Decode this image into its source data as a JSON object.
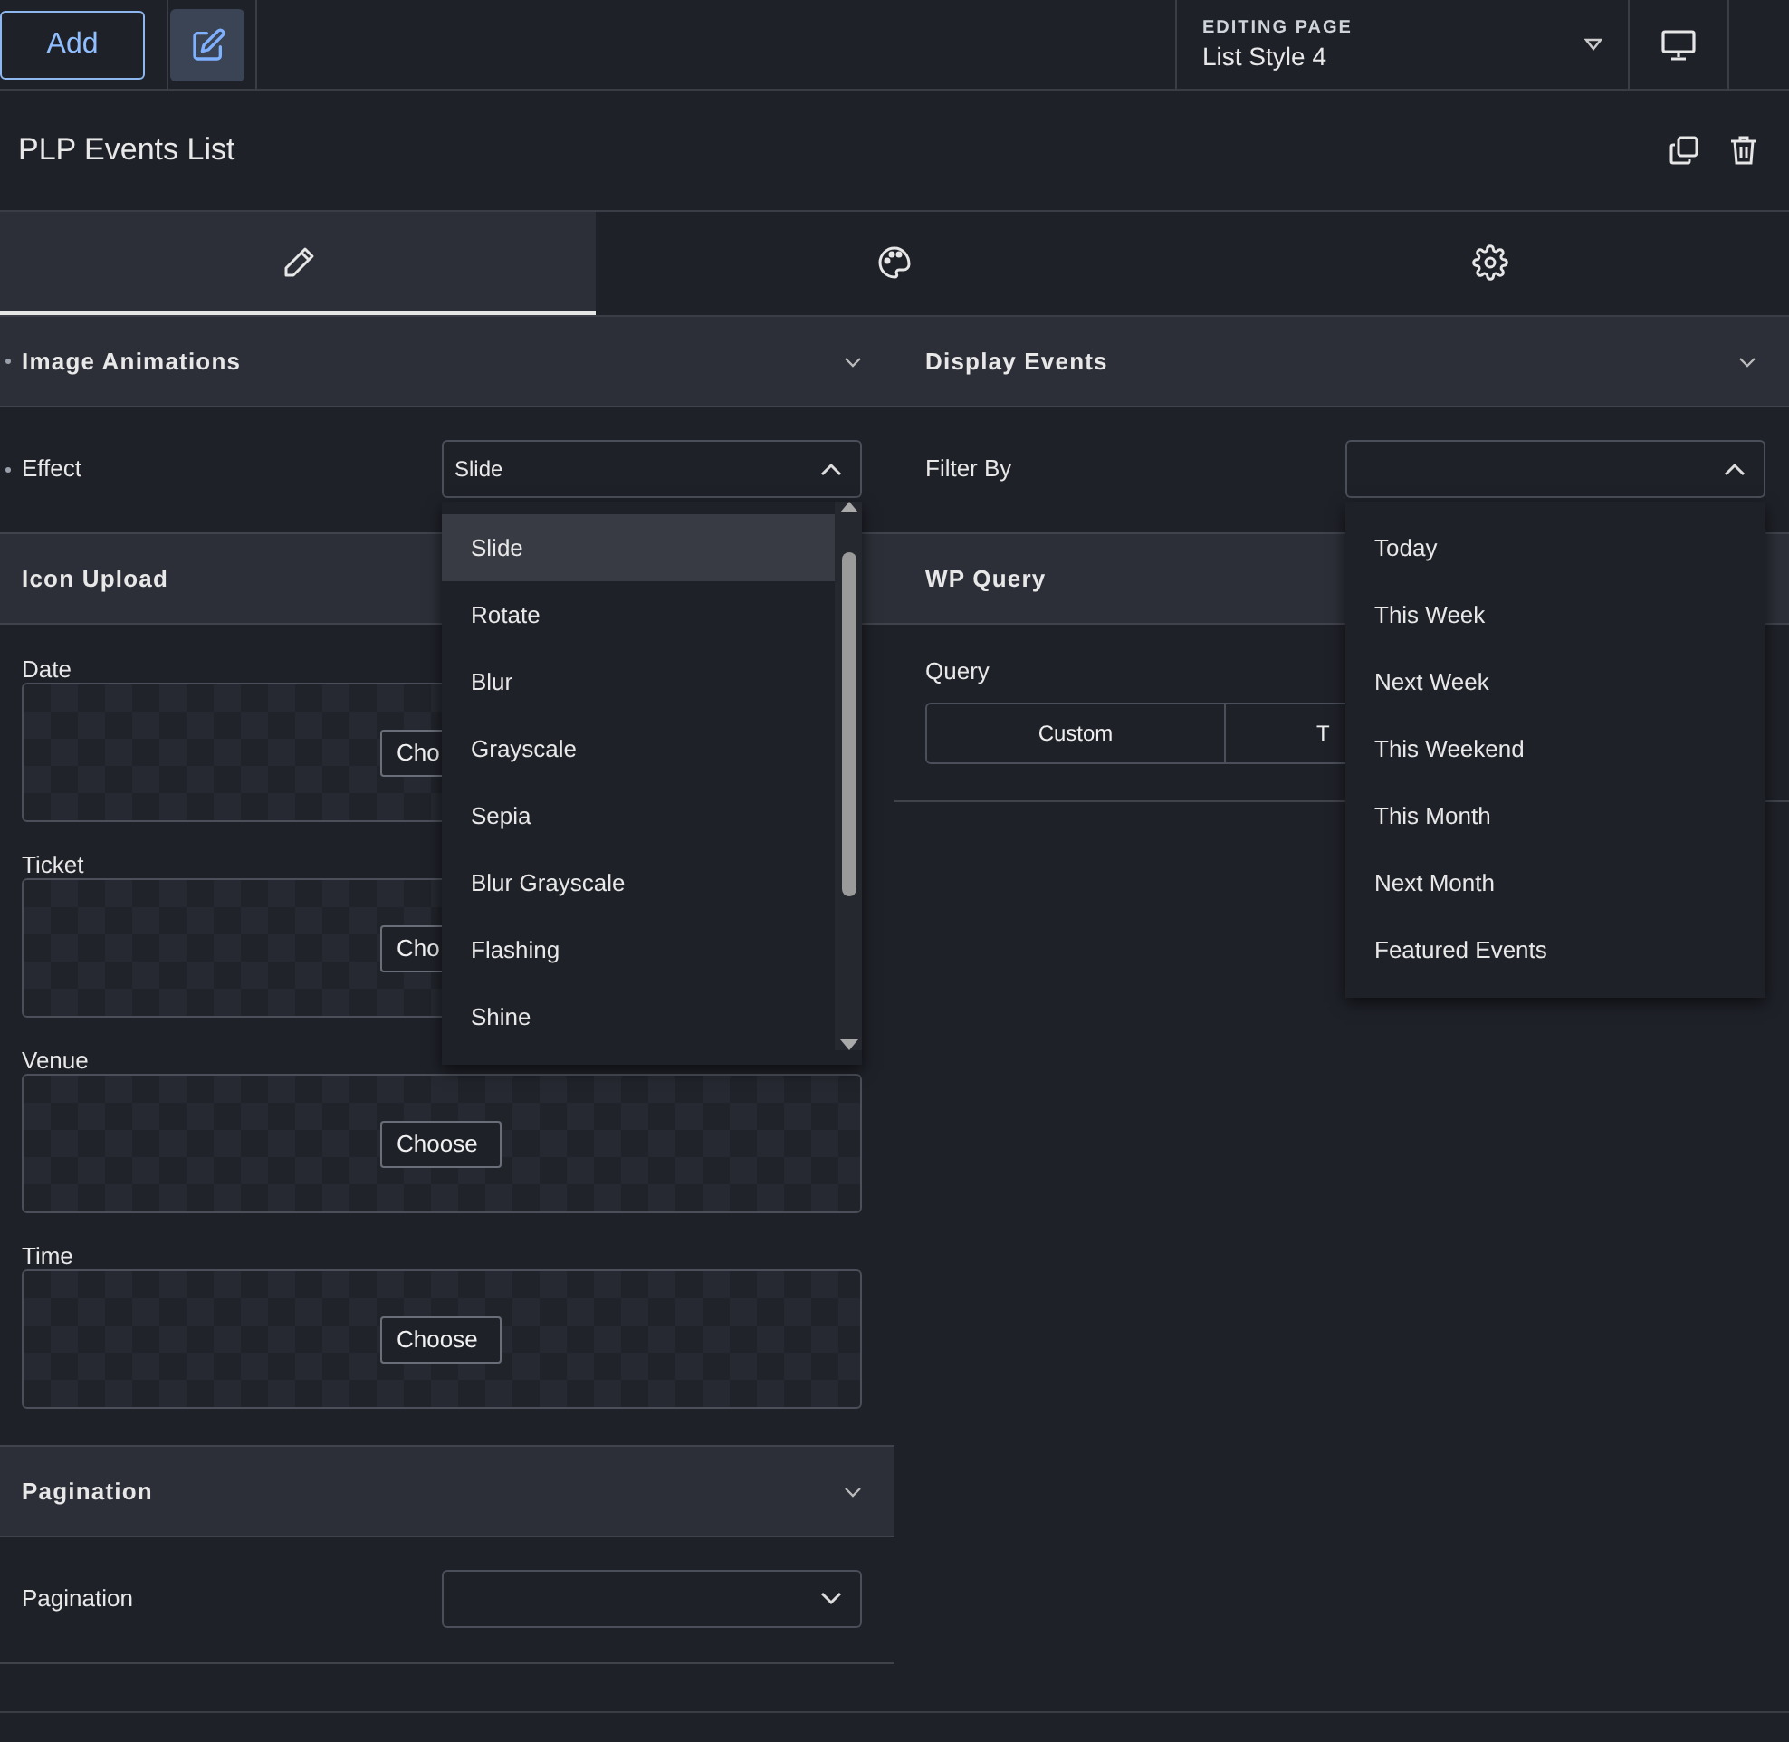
{
  "toolbar": {
    "add_button": "Add",
    "editing_label": "EDITING PAGE",
    "page_name": "List Style 4"
  },
  "widget": {
    "title": "PLP Events List"
  },
  "tabs": [
    {
      "selected": true
    },
    {
      "selected": false
    },
    {
      "selected": false
    }
  ],
  "columns": [
    [
      {
        "title": "Image Animations",
        "marked": true,
        "fields": [
          {
            "kind": "select",
            "label": "Effect",
            "marked": true,
            "value": "Slide",
            "open": true,
            "options": [
              {
                "label": "Slide",
                "selected": true
              },
              {
                "label": "Rotate",
                "selected": false
              },
              {
                "label": "Blur",
                "selected": false
              },
              {
                "label": "Grayscale",
                "selected": false
              },
              {
                "label": "Sepia",
                "selected": false
              },
              {
                "label": "Blur Grayscale",
                "selected": false
              },
              {
                "label": "Flashing",
                "selected": false
              },
              {
                "label": "Shine",
                "selected": false
              }
            ]
          }
        ]
      },
      {
        "title": "Icon Upload",
        "marked": false,
        "fields": [
          {
            "kind": "upload",
            "label": "Date",
            "button": "Cho"
          },
          {
            "kind": "upload",
            "label": "Ticket",
            "button": "Cho"
          },
          {
            "kind": "upload",
            "label": "Venue",
            "button": "Choose"
          },
          {
            "kind": "upload",
            "label": "Time",
            "button": "Choose"
          }
        ]
      },
      {
        "title": "Pagination",
        "marked": false,
        "fields": [
          {
            "kind": "select",
            "label": "Pagination",
            "marked": false,
            "open": false
          }
        ]
      }
    ],
    [
      {
        "title": "Display Events",
        "marked": false,
        "fields": [
          {
            "kind": "select",
            "label": "Filter By",
            "marked": false,
            "open": true,
            "options": [
              {
                "label": "Today",
                "selected": false
              },
              {
                "label": "This Week",
                "selected": false
              },
              {
                "label": "Next Week",
                "selected": false
              },
              {
                "label": "This Weekend",
                "selected": false
              },
              {
                "label": "This Month",
                "selected": false
              },
              {
                "label": "Next Month",
                "selected": false
              },
              {
                "label": "Featured Events",
                "selected": false
              }
            ]
          }
        ]
      },
      {
        "title": "WP Query",
        "marked": false,
        "fields": [
          {
            "kind": "segmented",
            "label": "Query",
            "options": [
              {
                "label": "Custom"
              },
              {
                "label": "T"
              }
            ]
          }
        ]
      }
    ]
  ]
}
